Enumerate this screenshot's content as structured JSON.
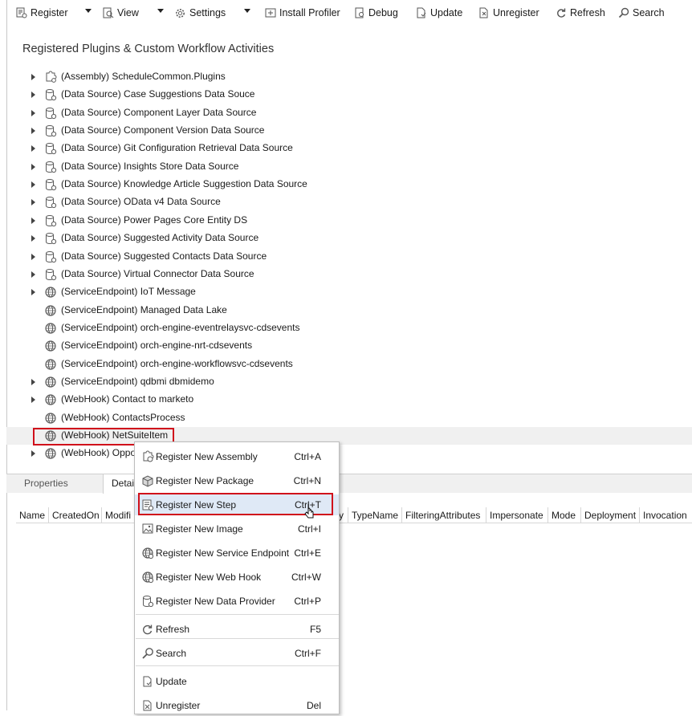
{
  "toolbar": {
    "register_label": "Register",
    "view_label": "View",
    "settings_label": "Settings",
    "install_profiler_label": "Install Profiler",
    "debug_label": "Debug",
    "update_label": "Update",
    "unregister_label": "Unregister",
    "refresh_label": "Refresh",
    "search_label": "Search"
  },
  "panel": {
    "title": "Registered Plugins & Custom Workflow Activities"
  },
  "tree": {
    "items": [
      {
        "label": "(Assembly) ScheduleCommon.Plugins",
        "icon": "puzzle-gear-icon",
        "expandable": true
      },
      {
        "label": "(Data Source) Case Suggestions Data Souce",
        "icon": "database-gear-icon",
        "expandable": true
      },
      {
        "label": "(Data Source) Component Layer Data Source",
        "icon": "database-gear-icon",
        "expandable": true
      },
      {
        "label": "(Data Source) Component Version Data Source",
        "icon": "database-gear-icon",
        "expandable": true
      },
      {
        "label": "(Data Source) Git Configuration Retrieval Data Source",
        "icon": "database-gear-icon",
        "expandable": true
      },
      {
        "label": "(Data Source) Insights Store Data Source",
        "icon": "database-gear-icon",
        "expandable": true
      },
      {
        "label": "(Data Source) Knowledge Article Suggestion Data Source",
        "icon": "database-gear-icon",
        "expandable": true
      },
      {
        "label": "(Data Source) OData v4 Data Source",
        "icon": "database-gear-icon",
        "expandable": true
      },
      {
        "label": "(Data Source) Power Pages Core Entity DS",
        "icon": "database-gear-icon",
        "expandable": true
      },
      {
        "label": "(Data Source) Suggested Activity Data Source",
        "icon": "database-gear-icon",
        "expandable": true
      },
      {
        "label": "(Data Source) Suggested Contacts Data Source",
        "icon": "database-gear-icon",
        "expandable": true
      },
      {
        "label": "(Data Source) Virtual Connector Data Source",
        "icon": "database-gear-icon",
        "expandable": true
      },
      {
        "label": "(ServiceEndpoint) IoT Message",
        "icon": "globe-icon",
        "expandable": true
      },
      {
        "label": "(ServiceEndpoint) Managed Data Lake",
        "icon": "globe-icon",
        "expandable": false
      },
      {
        "label": "(ServiceEndpoint) orch-engine-eventrelaysvc-cdsevents",
        "icon": "globe-icon",
        "expandable": false
      },
      {
        "label": "(ServiceEndpoint) orch-engine-nrt-cdsevents",
        "icon": "globe-icon",
        "expandable": false
      },
      {
        "label": "(ServiceEndpoint) orch-engine-workflowsvc-cdsevents",
        "icon": "globe-icon",
        "expandable": false
      },
      {
        "label": "(ServiceEndpoint) qdbmi dbmidemo",
        "icon": "globe-icon",
        "expandable": true
      },
      {
        "label": "(WebHook) Contact to marketo",
        "icon": "globe-icon",
        "expandable": true
      },
      {
        "label": "(WebHook) ContactsProcess",
        "icon": "globe-icon",
        "expandable": false
      },
      {
        "label": "(WebHook) NetSuiteItem",
        "icon": "globe-icon",
        "expandable": false,
        "selected": true
      },
      {
        "label": "(WebHook) Oppo",
        "icon": "globe-icon",
        "expandable": true
      }
    ]
  },
  "bottom_tabs": {
    "properties": "Properties",
    "details": "Detai"
  },
  "grid": {
    "columns": [
      "Name",
      "CreatedOn",
      "Modifi",
      "y",
      "TypeName",
      "FilteringAttributes",
      "Impersonate",
      "Mode",
      "Deployment",
      "Invocation"
    ]
  },
  "context_menu": {
    "items": [
      {
        "label": "Register New Assembly",
        "shortcut": "Ctrl+A",
        "icon": "assembly-gear-icon"
      },
      {
        "label": "Register New Package",
        "shortcut": "Ctrl+N",
        "icon": "package-icon"
      },
      {
        "label": "Register New Step",
        "shortcut": "Ctrl+T",
        "icon": "step-icon",
        "hover": true
      },
      {
        "label": "Register New Image",
        "shortcut": "Ctrl+I",
        "icon": "image-icon"
      },
      {
        "label": "Register New Service Endpoint",
        "shortcut": "Ctrl+E",
        "icon": "globe-gear-icon"
      },
      {
        "label": "Register New Web Hook",
        "shortcut": "Ctrl+W",
        "icon": "globe-gear-icon"
      },
      {
        "label": "Register New Data Provider",
        "shortcut": "Ctrl+P",
        "icon": "database-gear-icon"
      },
      {
        "label": "Refresh",
        "shortcut": "F5",
        "icon": "refresh-icon"
      },
      {
        "label": "Search",
        "shortcut": "Ctrl+F",
        "icon": "search-icon"
      },
      {
        "label": "Update",
        "shortcut": "",
        "icon": "update-icon"
      },
      {
        "label": "Unregister",
        "shortcut": "Del",
        "icon": "unregister-icon"
      }
    ]
  },
  "colors": {
    "highlight_border": "#d0101b",
    "menu_hover": "#dfe9f6",
    "selected_row": "#f0f0f0"
  }
}
